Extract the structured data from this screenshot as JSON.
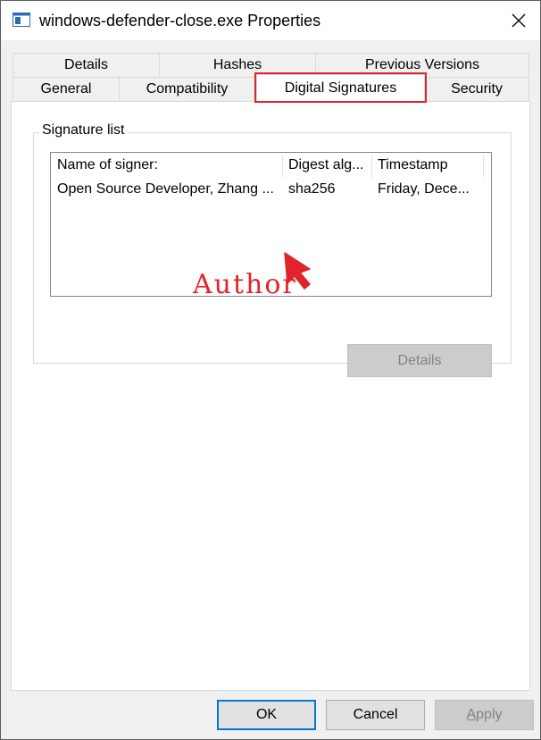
{
  "window": {
    "title": "windows-defender-close.exe Properties",
    "close_icon": "close-icon",
    "app_icon": "window-app-icon"
  },
  "tabs": {
    "row_top": [
      {
        "label": "Details"
      },
      {
        "label": "Hashes"
      },
      {
        "label": "Previous Versions"
      }
    ],
    "row_bottom": [
      {
        "label": "General"
      },
      {
        "label": "Compatibility"
      },
      {
        "label": "Digital Signatures",
        "active": true
      },
      {
        "label": "Security"
      }
    ]
  },
  "signature_list": {
    "group_label": "Signature list",
    "columns": [
      "Name of signer:",
      "Digest alg...",
      "Timestamp"
    ],
    "rows": [
      {
        "name": "Open Source Developer, Zhang ...",
        "digest": "sha256",
        "timestamp": "Friday, Dece..."
      }
    ],
    "details_button": "Details"
  },
  "annotation": {
    "text": "Author",
    "color": "#e0242c",
    "icon": "red-arrow-icon"
  },
  "footer": {
    "ok": "OK",
    "cancel": "Cancel",
    "apply_first": "A",
    "apply_rest": "pply"
  }
}
